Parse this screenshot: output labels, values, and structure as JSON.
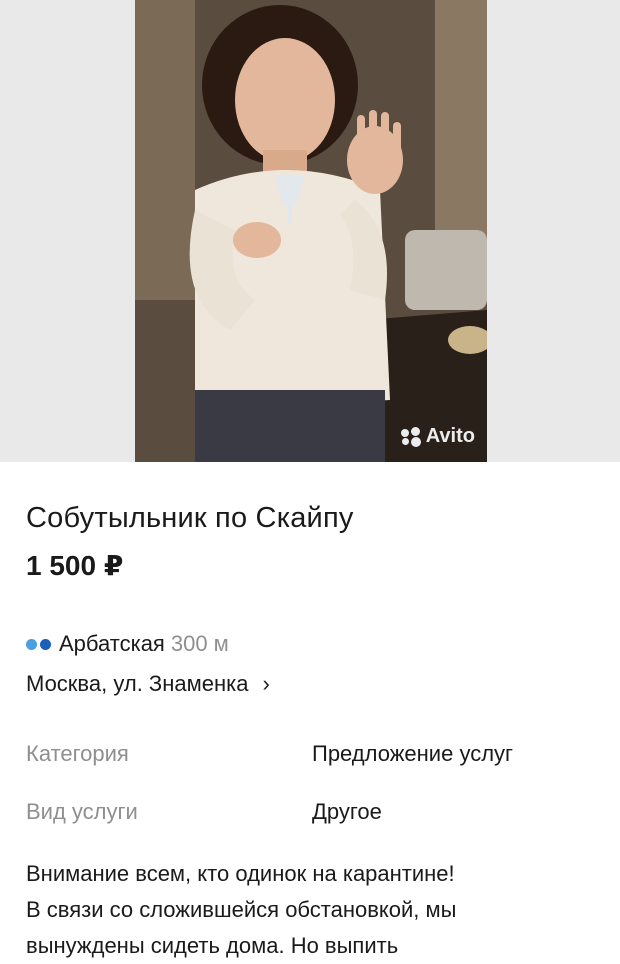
{
  "listing": {
    "title": "Собутыльник по Скайпу",
    "price": "1 500 ₽"
  },
  "photo": {
    "watermark": "Avito"
  },
  "location": {
    "metro_station": "Арбатская",
    "metro_distance": "300 м",
    "metro_colors": [
      "#4a9fe0",
      "#1c5fb8"
    ],
    "address": "Москва, ул. Знаменка",
    "chevron": "›"
  },
  "params": [
    {
      "key": "Категория",
      "value": "Предложение услуг"
    },
    {
      "key": "Вид услуги",
      "value": "Другое"
    }
  ],
  "description": {
    "lines": [
      "Внимание всем, кто одинок на карантине!",
      "В связи со сложившейся обстановкой, мы",
      "вынуждены сидеть дома. Но выпить"
    ]
  }
}
